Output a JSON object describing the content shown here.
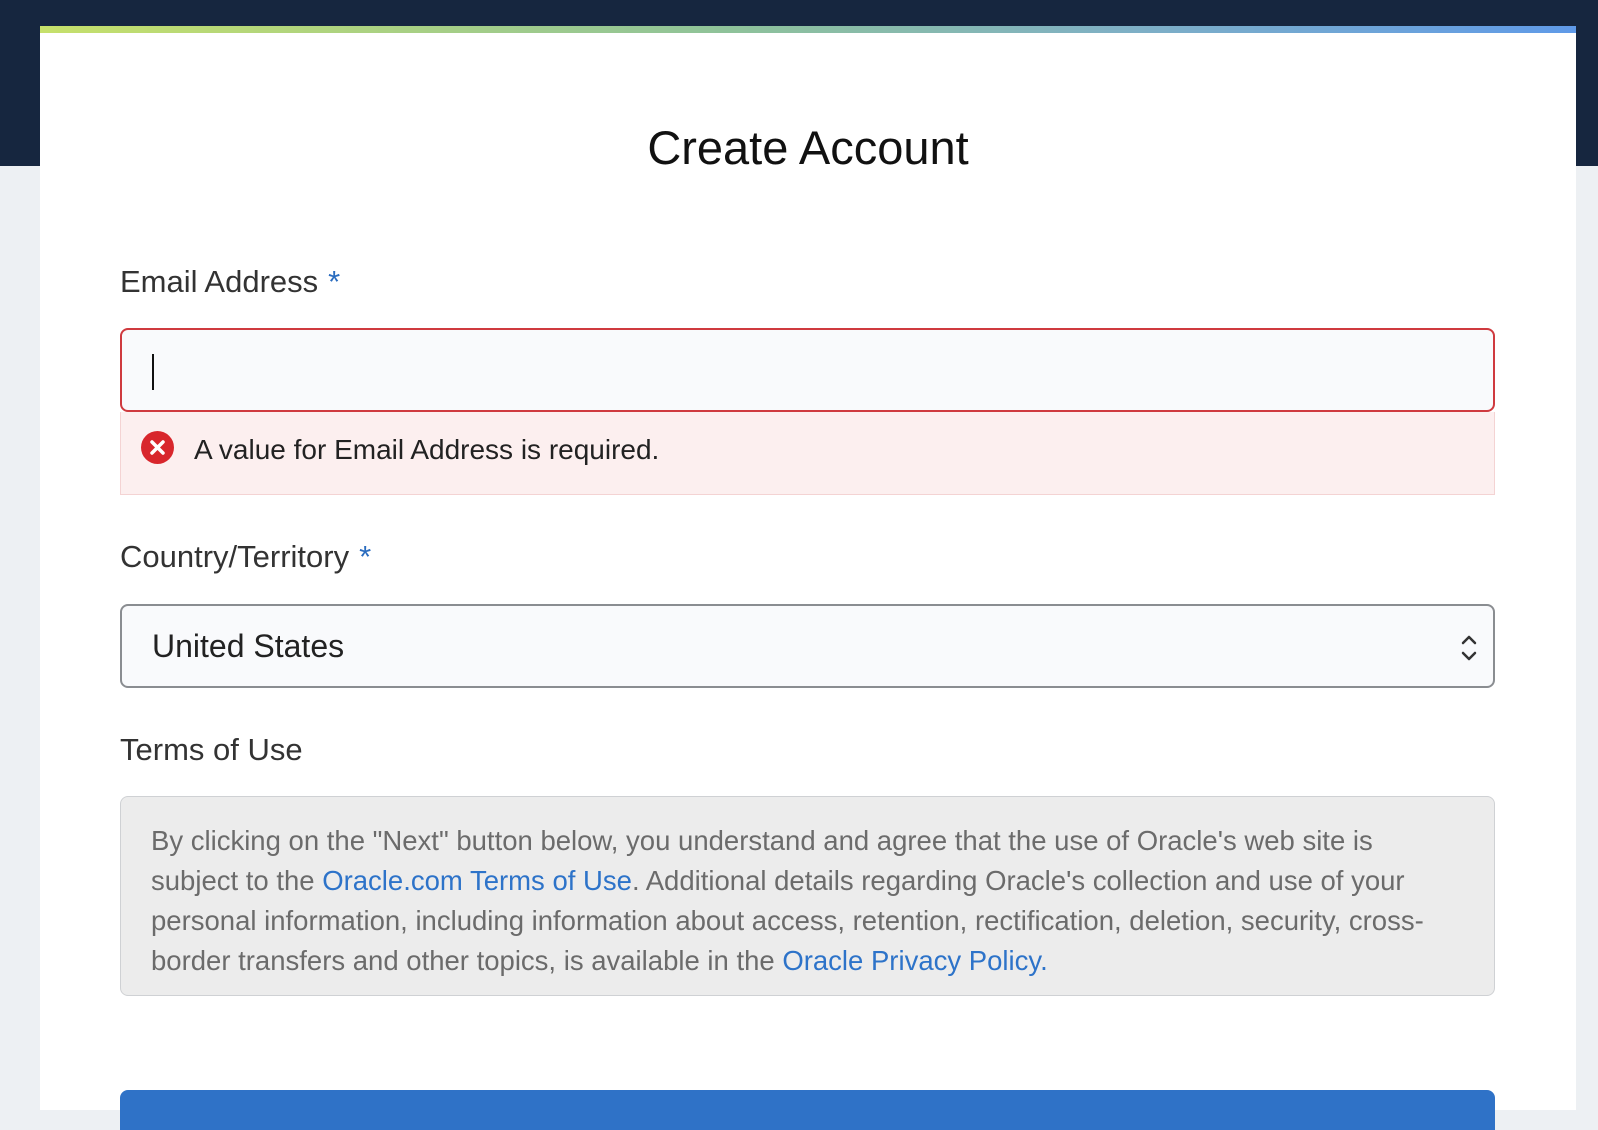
{
  "page": {
    "title": "Create Account"
  },
  "form": {
    "email": {
      "label": "Email Address",
      "required_mark": "*",
      "value": "",
      "error": "A value for Email Address is required."
    },
    "country": {
      "label": "Country/Territory",
      "required_mark": "*",
      "selected": "United States"
    },
    "terms": {
      "label": "Terms of Use",
      "text_before_link": "By clicking on the \"Next\" button below, you understand and agree that the use of Oracle's web site is subject to the ",
      "terms_link": "Oracle.com Terms of Use",
      "text_middle": ". Additional details regarding Oracle's collection and use of your personal information, including information about access, retention, rectification, deletion, security, cross-border transfers and other topics, is available in the ",
      "privacy_link": "Oracle Privacy Policy."
    }
  },
  "icons": {
    "error": "error-circle-x-icon",
    "select": "chevron-up-down-icon"
  },
  "colors": {
    "header_band": "#16263f",
    "error_border": "#cf3a3f",
    "error_background": "#fcefef",
    "error_icon": "#d8262c",
    "link": "#2d73c9",
    "required_mark": "#2a6cbf",
    "primary_button": "#2f72c7"
  }
}
